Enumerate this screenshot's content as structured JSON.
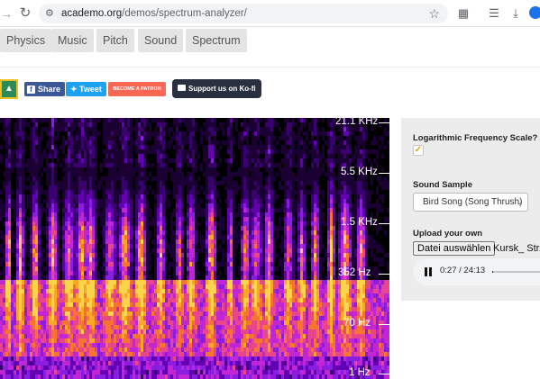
{
  "browser": {
    "url_host": "academo.org",
    "url_path": "/demos/spectrum-analyzer/"
  },
  "nav": {
    "items": [
      "Physics",
      "Music",
      "Pitch",
      "Sound",
      "Spectrum"
    ]
  },
  "share": {
    "facebook": "Share",
    "twitter": "Tweet",
    "patreon": "BECOME A PATRON",
    "kofi": "Support us on Ko-fi"
  },
  "spectrogram": {
    "frequency_labels": [
      "21.1 KHz",
      "5.5 KHz",
      "1.5 KHz",
      "352 Hz",
      "70 Hz",
      "1 Hz"
    ]
  },
  "panel": {
    "log_scale_label": "Logarithmic Frequency Scale?",
    "log_scale_checked": true,
    "sound_sample_label": "Sound Sample",
    "sound_sample_value": "Bird Song (Song Thrush)",
    "upload_label": "Upload your own",
    "file_button": "Datei auswählen",
    "file_name": "Kursk_ Str...",
    "audio_time": "0:27 / 24:13",
    "audio_progress": 0.019
  },
  "colors": {
    "accent_check": "#e8a000",
    "facebook": "#3b5998",
    "twitter": "#1da1f2",
    "patreon": "#f96854",
    "kofi": "#29303f"
  },
  "icons": {
    "forward": "arrow-right-icon",
    "reload": "reload-icon",
    "site_settings": "tune-icon",
    "bookmark": "star-icon",
    "extensions": "puzzle-icon",
    "media": "media-controls-icon",
    "download": "download-icon",
    "profile": "profile-icon",
    "classroom": "classroom-icon",
    "pause": "pause-icon"
  }
}
